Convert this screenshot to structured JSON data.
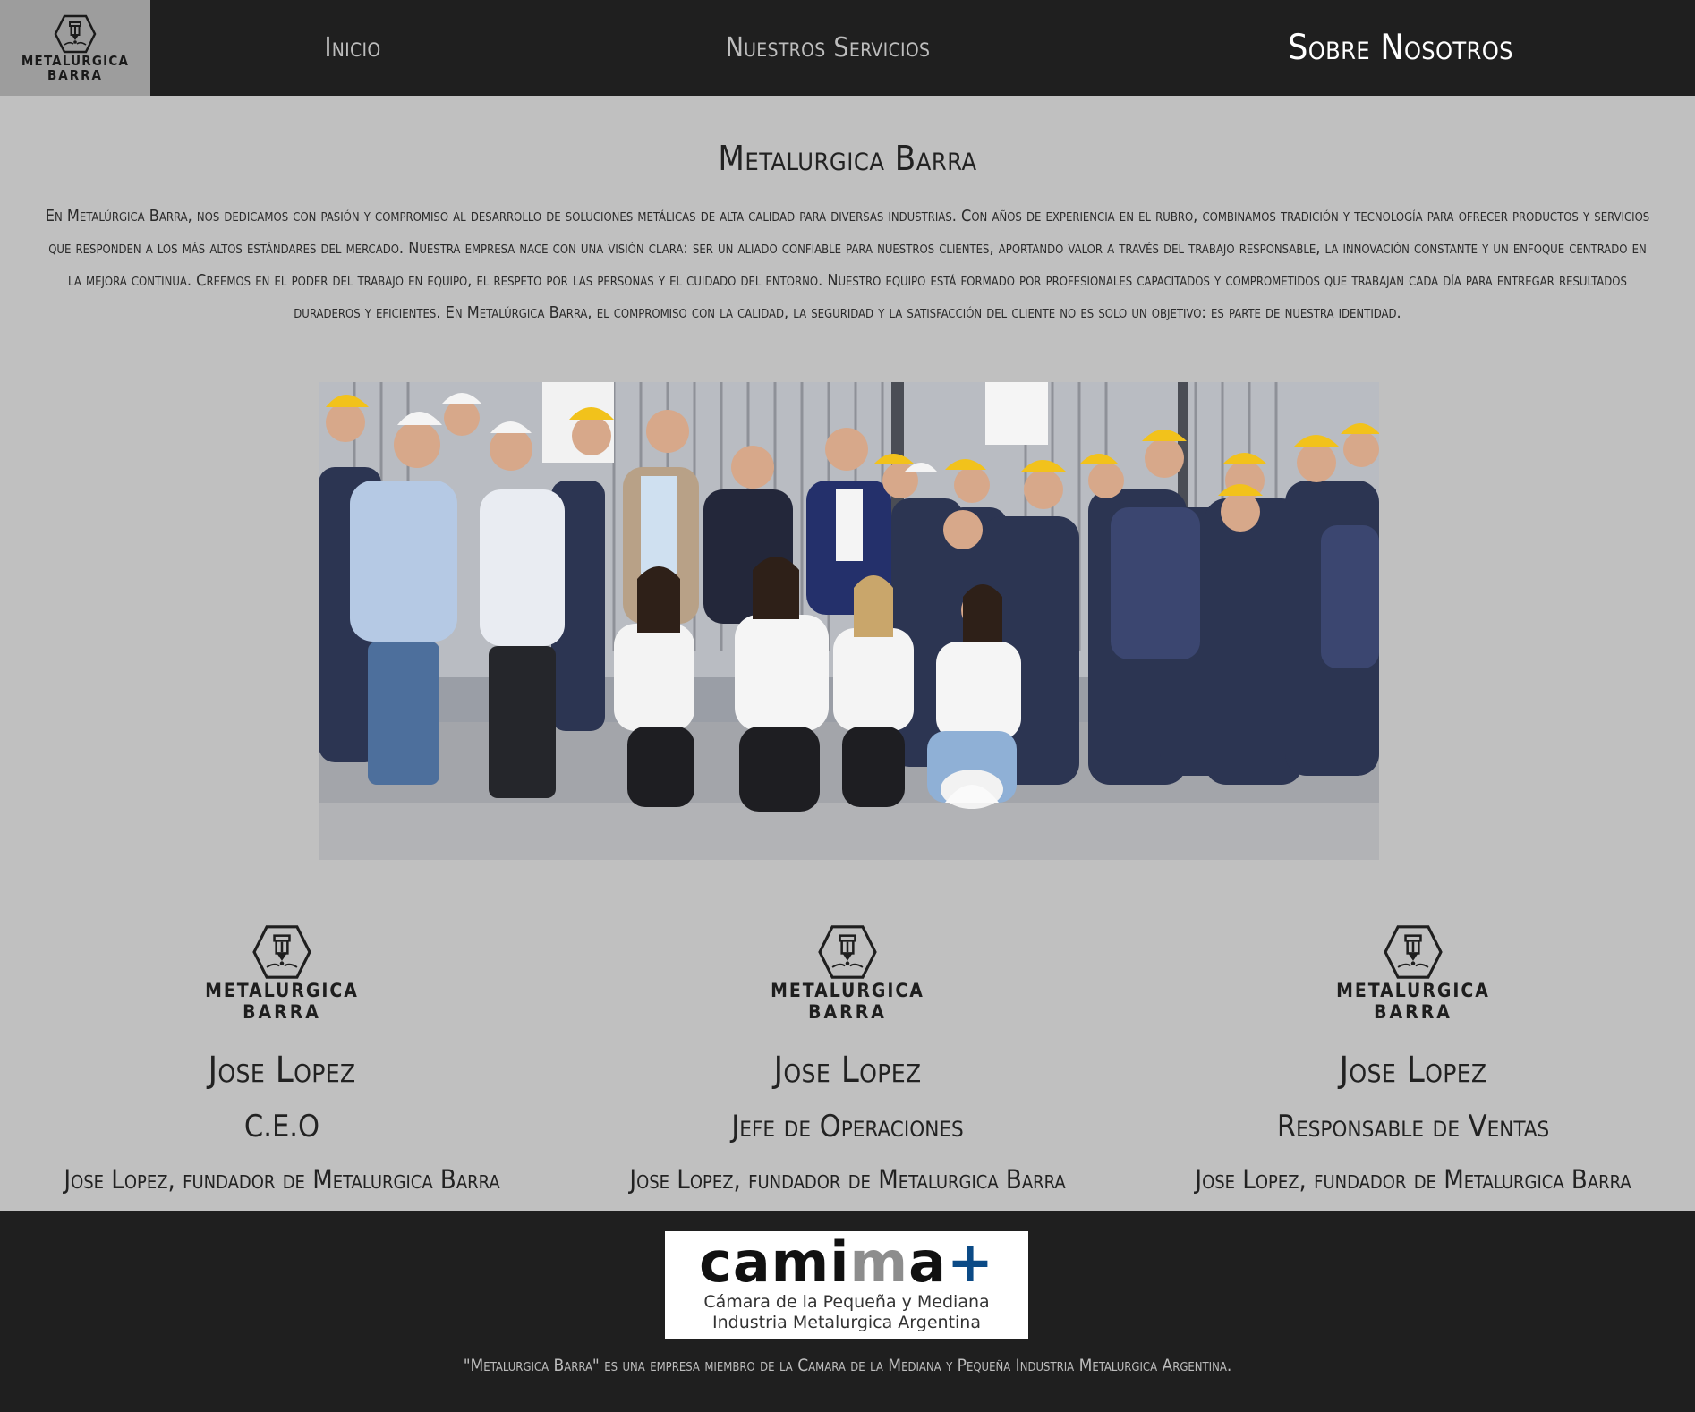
{
  "header": {
    "brand": {
      "line1": "METALURGICA",
      "line2": "BARRA",
      "icon": "laser-cutter-hexagon-icon"
    },
    "nav": [
      {
        "label": "Inicio"
      },
      {
        "label": "Nuestros Servicios"
      },
      {
        "label": "Sobre Nosotros",
        "active": true
      }
    ]
  },
  "about": {
    "title": "Metalurgica Barra",
    "paragraph": "En Metalúrgica Barra, nos dedicamos con pasión y compromiso al desarrollo de soluciones metálicas de alta calidad para diversas industrias. Con años de experiencia en el rubro, combinamos tradición y tecnología para ofrecer productos y servicios que responden a los más altos estándares del mercado. Nuestra empresa nace con una visión clara: ser un aliado confiable para nuestros clientes, aportando valor a través del trabajo responsable, la innovación constante y un enfoque centrado en la mejora continua. Creemos en el poder del trabajo en equipo, el respeto por las personas y el cuidado del entorno. Nuestro equipo está formado por profesionales capacitados y comprometidos que trabajan cada día para entregar resultados duraderos y eficientes. En Metalúrgica Barra, el compromiso con la calidad, la seguridad y la satisfacción del cliente no es solo un objetivo: es parte de nuestra identidad."
  },
  "team": [
    {
      "logo_line1": "METALURGICA",
      "logo_line2": "BARRA",
      "name": "Jose Lopez",
      "role": "C.E.O",
      "description": "Jose Lopez, fundador de Metalurgica Barra"
    },
    {
      "logo_line1": "METALURGICA",
      "logo_line2": "BARRA",
      "name": "Jose Lopez",
      "role": "Jefe de Operaciones",
      "description": "Jose Lopez, fundador de Metalurgica Barra"
    },
    {
      "logo_line1": "METALURGICA",
      "logo_line2": "BARRA",
      "name": "Jose Lopez",
      "role": "Responsable de Ventas",
      "description": "Jose Lopez, fundador de Metalurgica Barra"
    }
  ],
  "footer": {
    "partner_logo": {
      "word_dark_1": "cami",
      "word_grey": "m",
      "word_dark_2": "a",
      "word_plus": "+",
      "subtitle_line1": "Cámara de la Pequeña y Mediana",
      "subtitle_line2": "Industria Metalurgica Argentina"
    },
    "note": "\"Metalurgica Barra\" es una empresa miembro de la Camara de la Mediana y Pequeña Industria Metalurgica Argentina."
  },
  "colors": {
    "header_bg": "#1f1f1f",
    "brand_bg": "#9d9d9d",
    "page_bg": "#c0c0c0",
    "nav_text": "#bdbdbd",
    "nav_active": "#ffffff",
    "camima_plus": "#0b4a86"
  }
}
